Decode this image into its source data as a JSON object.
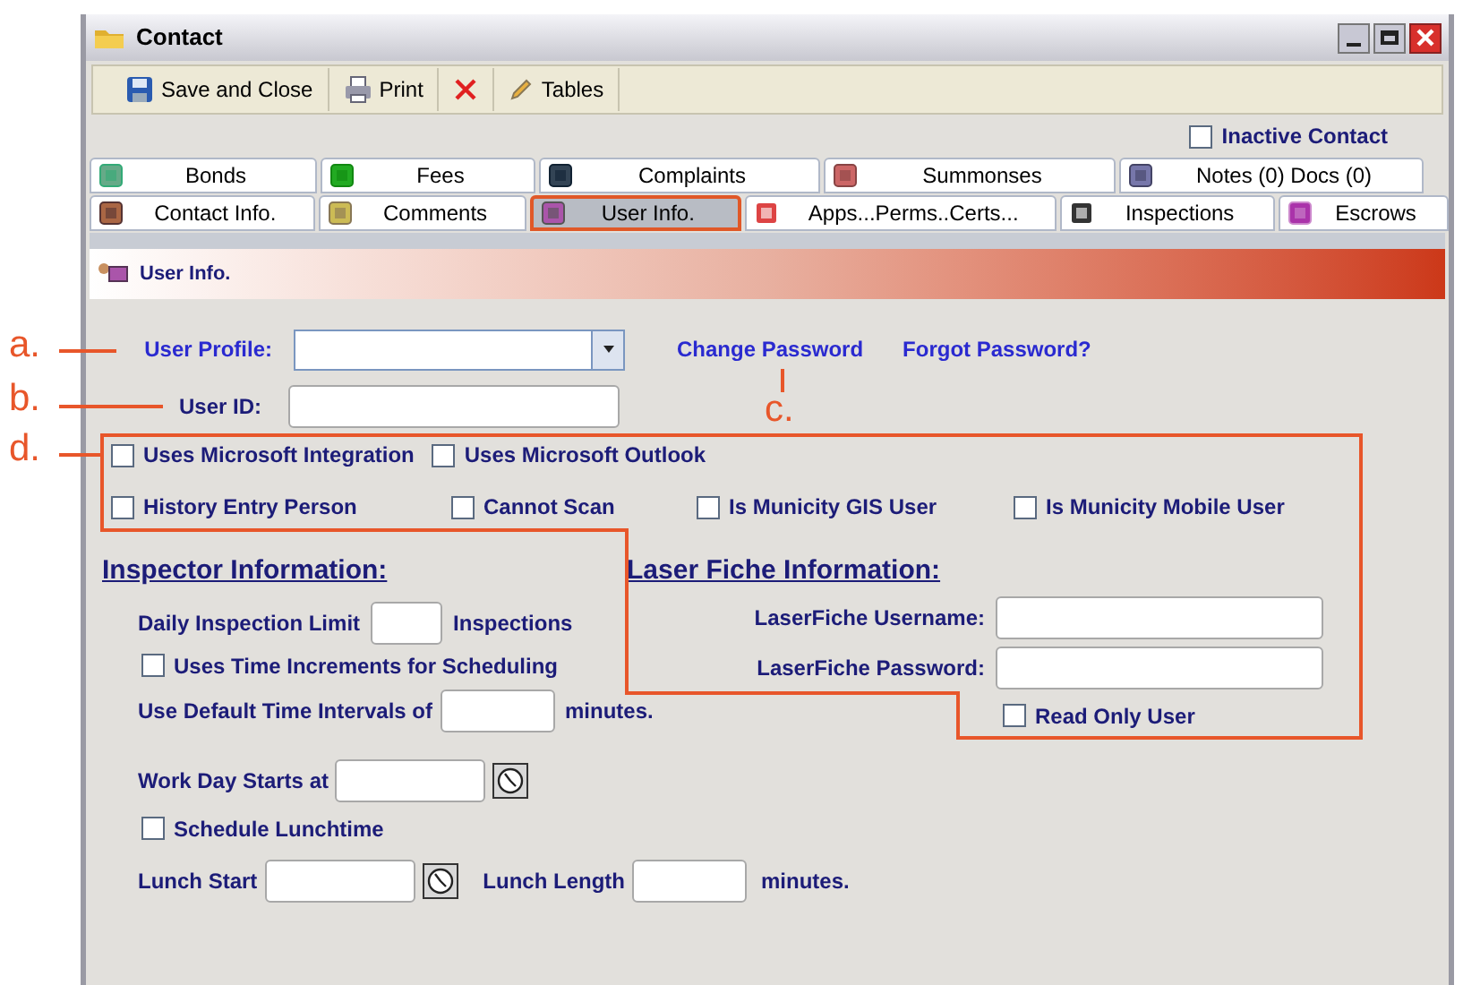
{
  "window": {
    "title": "Contact"
  },
  "toolbar": [
    {
      "kind": "save",
      "label": "Save and Close"
    },
    {
      "kind": "print",
      "label": "Print"
    },
    {
      "kind": "delete"
    },
    {
      "kind": "tables",
      "label": "Tables"
    }
  ],
  "inactive_contact": {
    "label": "Inactive Contact",
    "checked": false
  },
  "tab_rows": [
    [
      {
        "label": "Bonds",
        "selected": false
      },
      {
        "label": "Fees",
        "selected": false
      },
      {
        "label": "Complaints",
        "selected": false
      },
      {
        "label": "Summonses",
        "selected": false
      },
      {
        "label": "Notes (0) Docs (0)",
        "selected": false
      }
    ],
    [
      {
        "label": "Contact Info.",
        "selected": false
      },
      {
        "label": "Comments",
        "selected": false
      },
      {
        "label": "User Info.",
        "selected": true
      },
      {
        "label": "Apps...Perms..Certs...",
        "selected": false
      },
      {
        "label": "Inspections",
        "selected": false
      },
      {
        "label": "Escrows",
        "selected": false
      }
    ]
  ],
  "section_header": {
    "title": "User Info."
  },
  "user_profile": {
    "label": "User Profile:"
  },
  "links": [
    "Change Password",
    "Forgot Password?"
  ],
  "user_id": {
    "label": "User ID:"
  },
  "options": [
    [
      {
        "label": "Uses Microsoft Integration",
        "checked": false
      },
      {
        "label": "Uses Microsoft Outlook",
        "checked": false
      }
    ],
    [
      {
        "label": "History Entry Person",
        "checked": false
      },
      {
        "label": "Cannot Scan",
        "checked": false
      },
      {
        "label": "Is Municity GIS User",
        "checked": false
      },
      {
        "label": "Is Municity Mobile User",
        "checked": false
      }
    ]
  ],
  "inspector": {
    "heading": "Inspector Information:",
    "daily_limit_label": "Daily Inspection Limit",
    "daily_limit_unit": "Inspections",
    "time_increments": {
      "label": "Uses Time Increments for Scheduling",
      "checked": false
    },
    "default_interval_label": "Use Default Time Intervals of",
    "default_interval_unit": "minutes.",
    "work_day_label": "Work Day Starts at",
    "lunchtime": {
      "label": "Schedule Lunchtime",
      "checked": false
    },
    "lunch_start_label": "Lunch Start",
    "lunch_length_label": "Lunch Length",
    "lunch_length_unit": "minutes."
  },
  "laserfiche": {
    "heading": "Laser Fiche Information:",
    "username_label": "LaserFiche Username:",
    "password_label": "LaserFiche Password:",
    "read_only": {
      "label": "Read Only User",
      "checked": false
    }
  },
  "annotations": [
    {
      "label": "a."
    },
    {
      "label": "b."
    },
    {
      "label": "c."
    },
    {
      "label": "d."
    }
  ]
}
